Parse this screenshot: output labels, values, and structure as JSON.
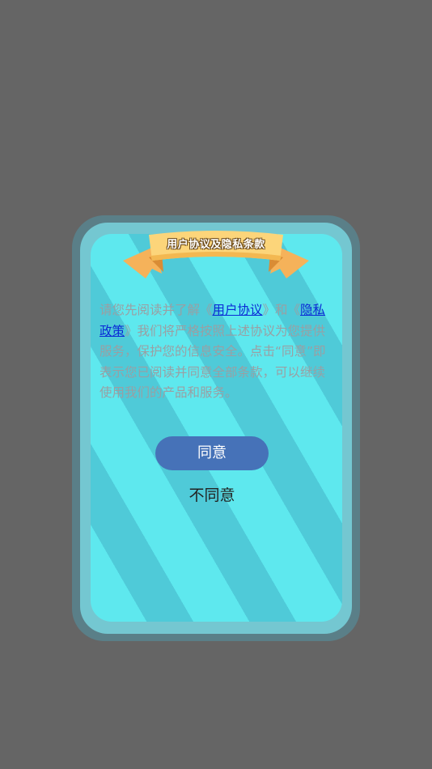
{
  "dialog": {
    "ribbon_title": "用户协议及隐私条款",
    "text_before_link1": "请您先阅读并了解《",
    "link_user_agreement": "用户协议",
    "text_between": "》和《",
    "link_privacy_policy": "隐私政策",
    "text_after": "》我们将严格按照上述协议为您提供服务，保护您的信息安全。点击“同意”即表示您已阅读并同意全部条款，可以继续使用我们的产品和服务。",
    "agree_label": "同意",
    "disagree_label": "不同意"
  },
  "colors": {
    "backdrop": "#656565",
    "card_frame": "#74c7d1",
    "stripe_light": "#5ee8ee",
    "stripe_dark": "#4fcad8",
    "ribbon": "#fcd57a",
    "agree_button": "#4672b8",
    "link": "#0b2bd6",
    "body_text": "#9a9fa3"
  }
}
